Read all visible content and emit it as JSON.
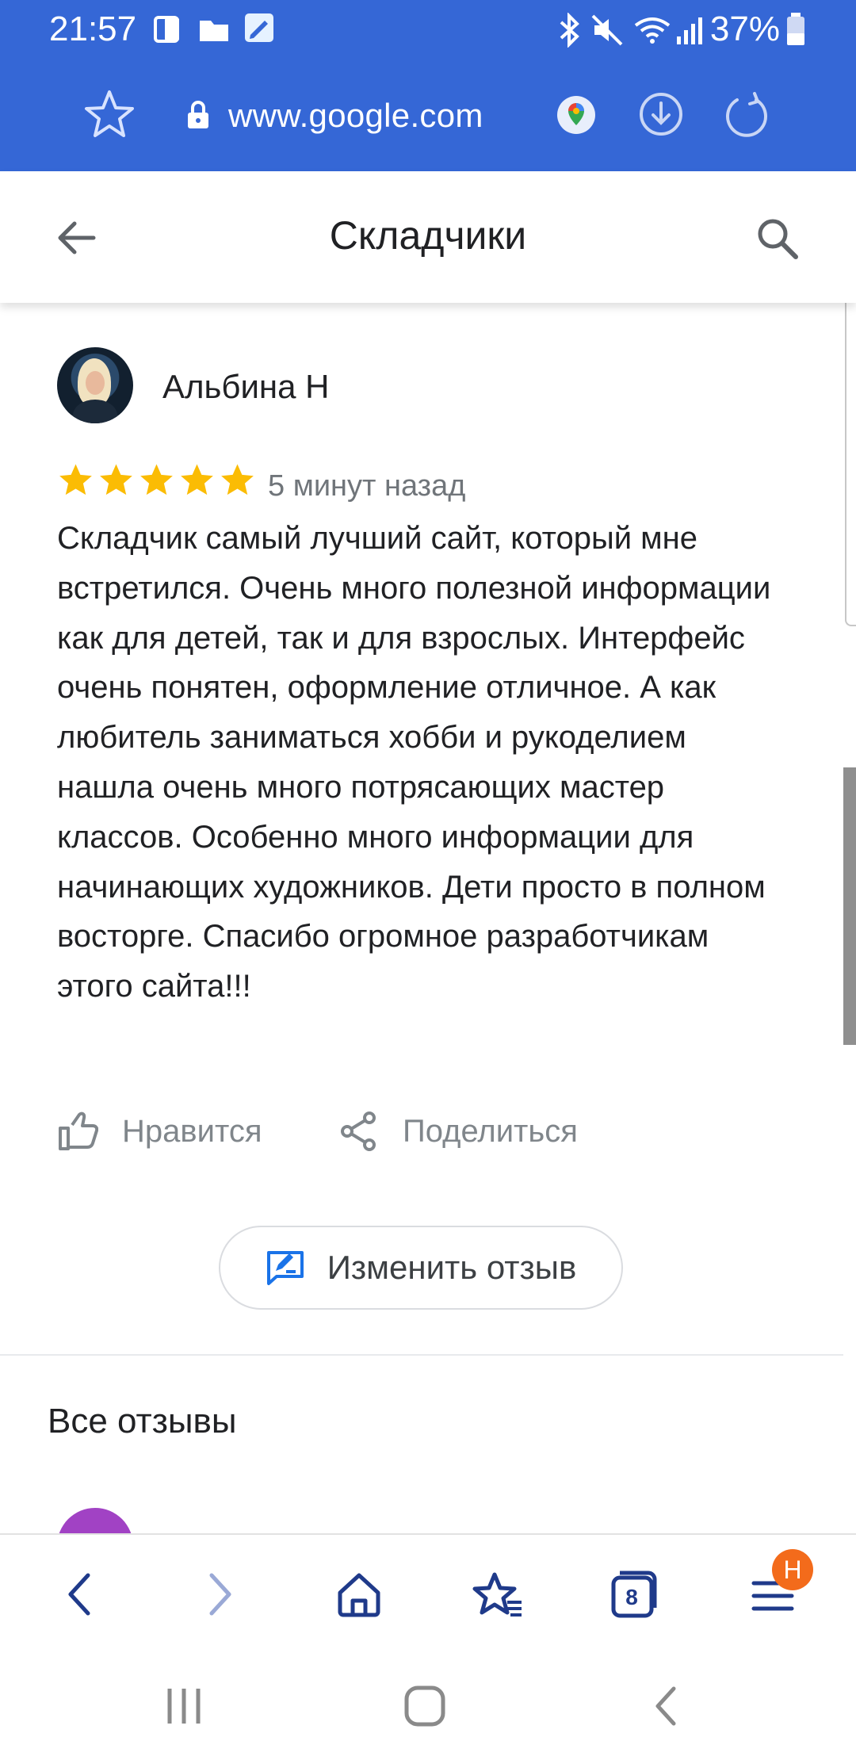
{
  "status_bar": {
    "time": "21:57",
    "battery": "37%"
  },
  "browser": {
    "url": "www.google.com"
  },
  "header": {
    "title": "Складчики",
    "back_icon": "arrow-left-icon",
    "search_icon": "search-icon"
  },
  "review": {
    "author": "Альбина Н",
    "rating": 5,
    "rating_max": 5,
    "time_ago": "5 минут назад",
    "text": "Складчик самый лучший сайт, который мне встретился. Очень много полезной информации как для детей, так и для взрослых. Интерфейс очень понятен, оформление отличное. А как любитель заниматься хобби и рукоделием нашла очень много потрясающих мастер классов. Особенно много информации для начинающих художников. Дети просто в полном восторге. Спасибо огромное разработчикам этого сайта!!!",
    "like_label": "Нравится",
    "share_label": "Поделиться",
    "edit_label": "Изменить отзыв"
  },
  "all_reviews": {
    "title": "Все отзывы"
  },
  "bottom_bar": {
    "tab_count": "8",
    "menu_badge": "H"
  },
  "colors": {
    "browser_bar": "#3567d6",
    "star": "#fbbc04",
    "nav_icon": "#1f3a8a",
    "badge": "#f36b1b"
  }
}
